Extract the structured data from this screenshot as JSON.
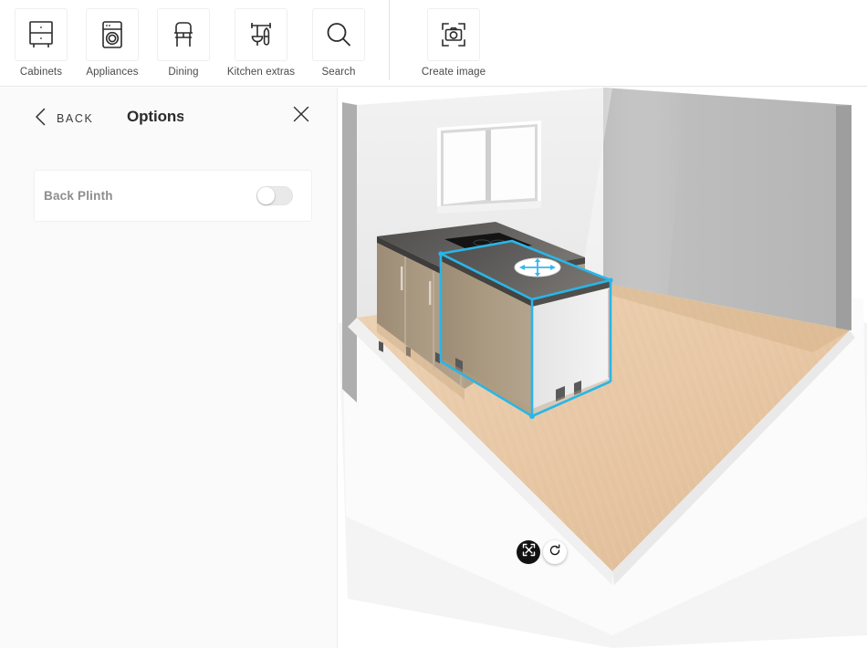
{
  "toolbar": {
    "items": [
      {
        "label": "Cabinets",
        "icon": "cabinet-icon"
      },
      {
        "label": "Appliances",
        "icon": "appliance-icon"
      },
      {
        "label": "Dining",
        "icon": "chair-icon"
      },
      {
        "label": "Kitchen extras",
        "icon": "utensils-icon"
      },
      {
        "label": "Search",
        "icon": "search-icon"
      }
    ],
    "create": {
      "label": "Create image",
      "icon": "camera-icon"
    }
  },
  "panel": {
    "back_label": "BACK",
    "title": "Options",
    "close_icon": "close-icon",
    "back_icon": "chevron-left-icon",
    "options": [
      {
        "label": "Back Plinth",
        "enabled": false
      }
    ]
  },
  "viewport": {
    "gizmo": {
      "move_icon": "move-arrows-icon",
      "rotate_icon": "rotate-icon",
      "floor_handle_icon": "translate-plane-icon"
    },
    "scene": {
      "description": "3D kitchen room view",
      "selection_color": "#29b6e8",
      "back_wall_color": "#eeeeee",
      "right_wall_color": "#b9b9b9",
      "floor_color": "#e9c9a6",
      "cabinet_front_color": "#a8977f",
      "worktop_color": "#5c5a58",
      "hob_color": "#161616"
    }
  }
}
